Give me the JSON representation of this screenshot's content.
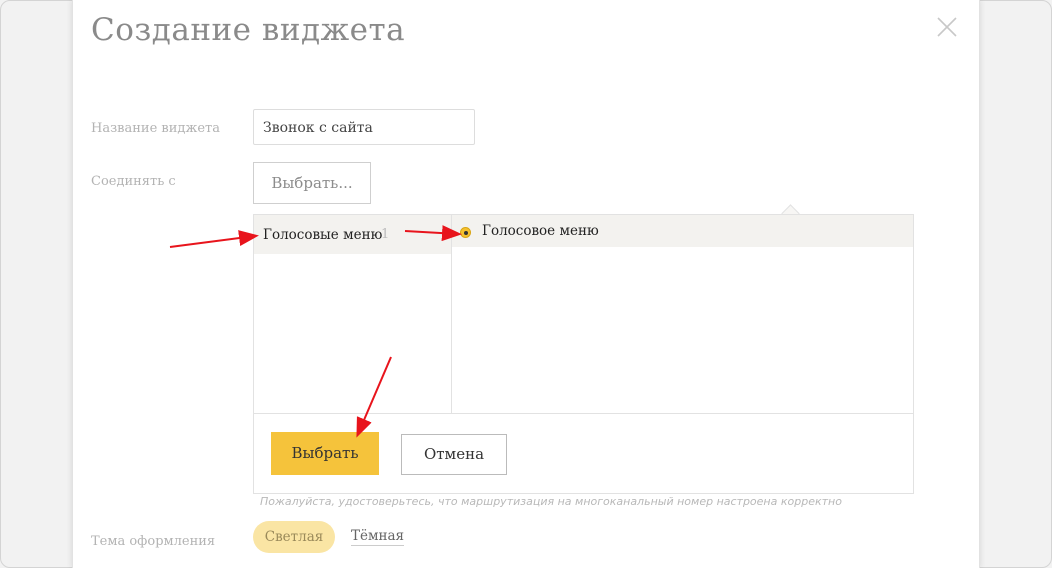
{
  "modal": {
    "title": "Создание виджета",
    "close_icon": "close-icon"
  },
  "form": {
    "widget_name_label": "Название виджета",
    "widget_name_value": "Звонок с сайта",
    "connect_label": "Соединять с",
    "connect_button": "Выбрать..."
  },
  "picker": {
    "categories": [
      {
        "label": "Голосовые меню",
        "count": "1"
      }
    ],
    "options": [
      {
        "label": "Голосовое меню",
        "selected": true
      }
    ],
    "select_button": "Выбрать",
    "cancel_button": "Отмена"
  },
  "hint": "Пожалуйста, удостоверьтесь, что маршрутизация на многоканальный номер настроена корректно",
  "theme": {
    "label": "Тема оформления",
    "light": "Светлая",
    "dark": "Тёмная"
  },
  "colors": {
    "accent": "#f5c33b",
    "annotation_arrow": "#e8141c"
  }
}
